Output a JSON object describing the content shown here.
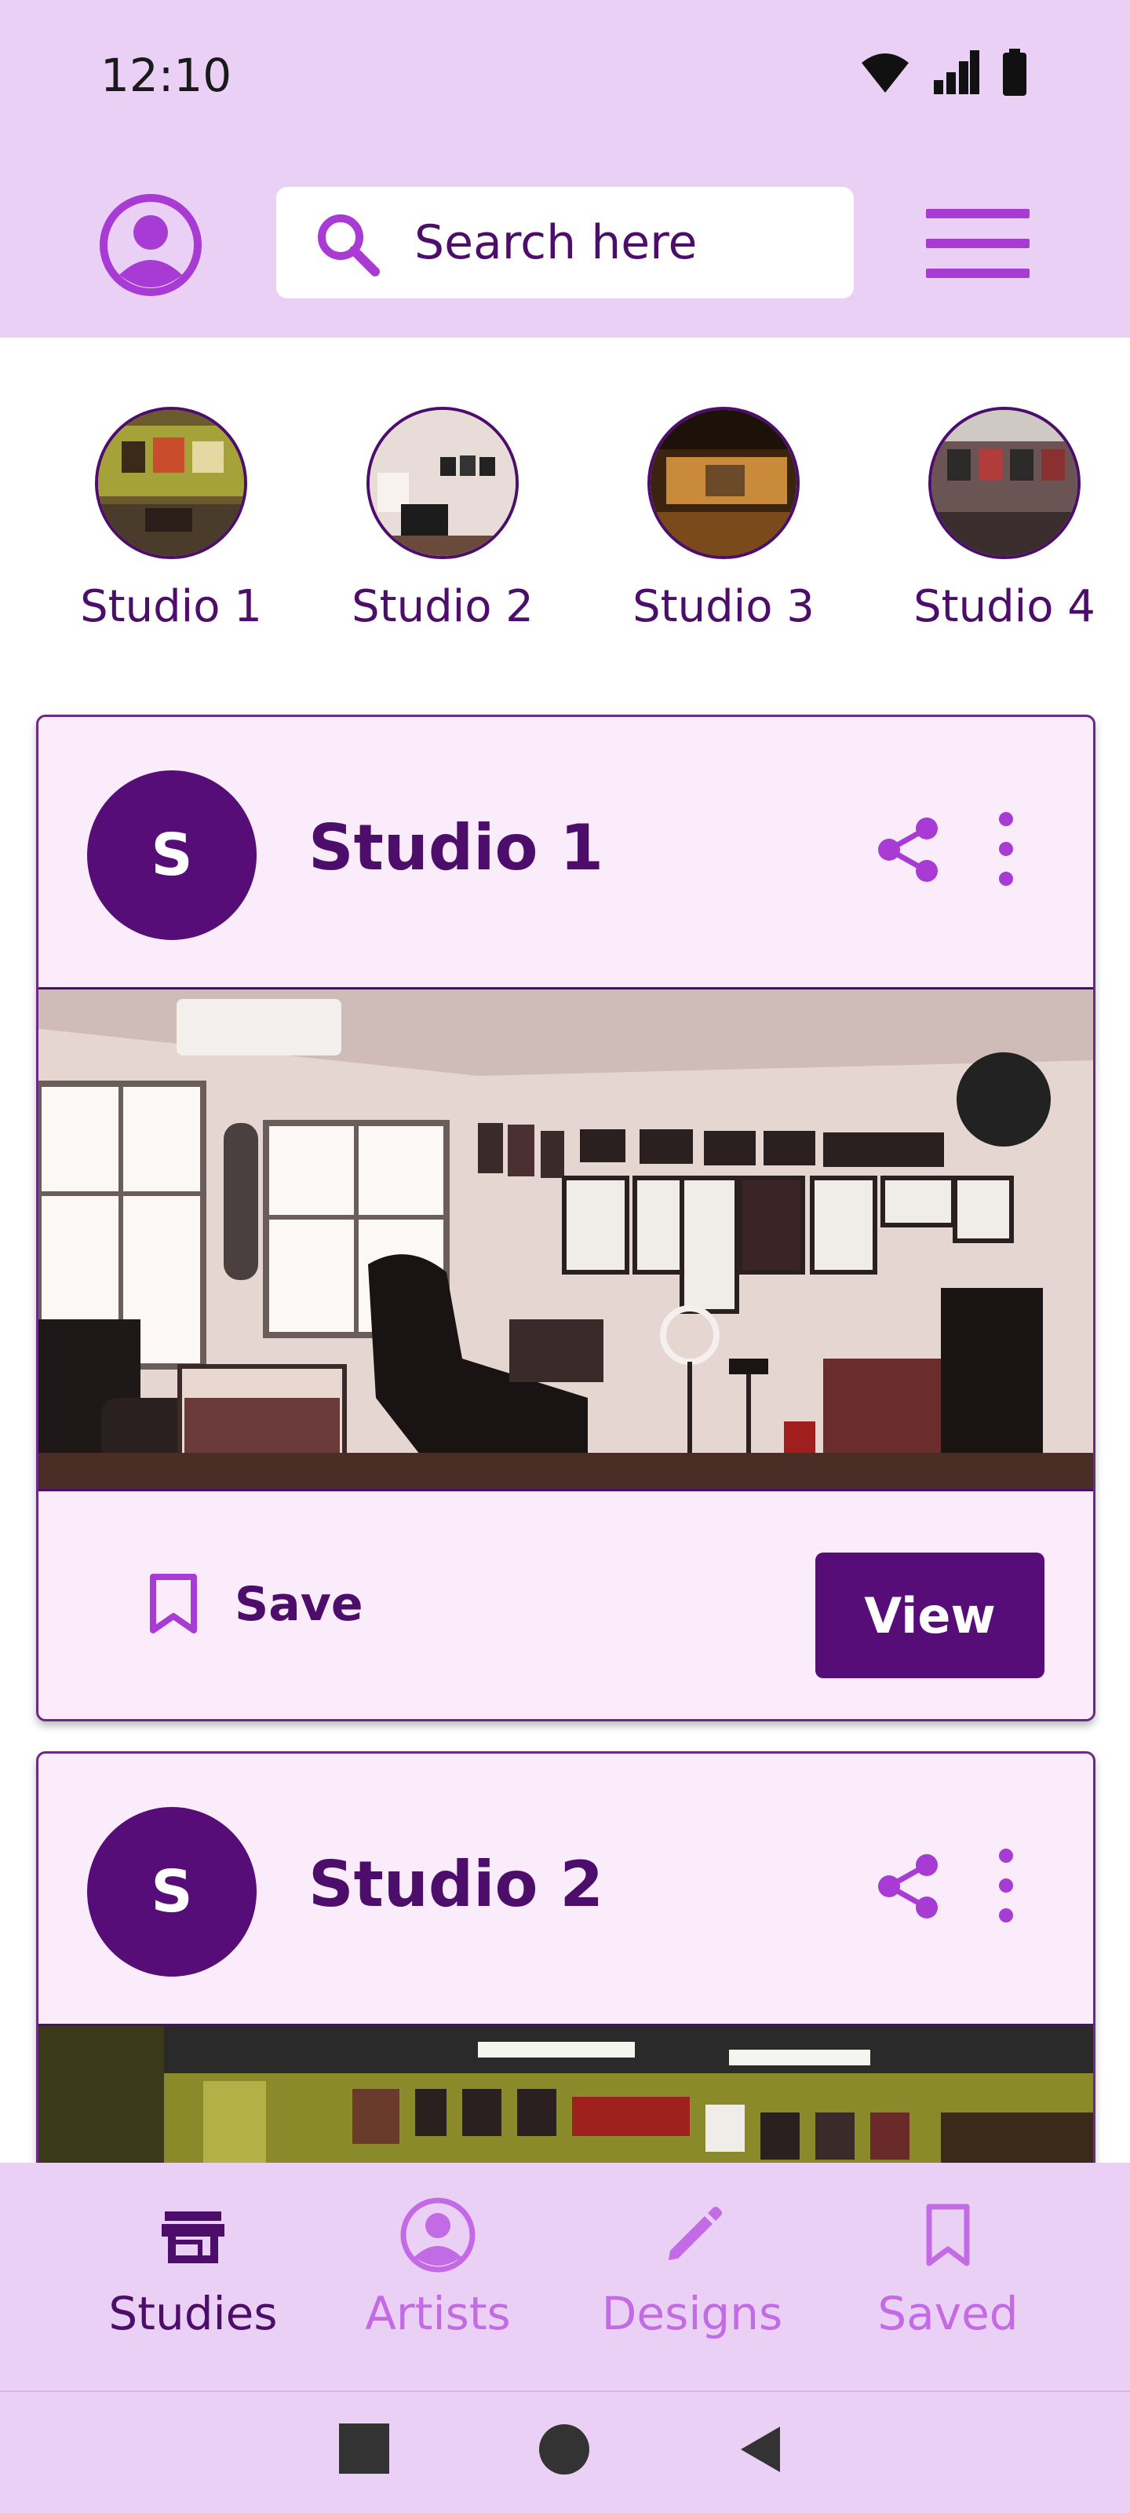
{
  "status_bar": {
    "time": "12:10"
  },
  "app_bar": {
    "search": {
      "placeholder": "Search here"
    }
  },
  "stories": [
    {
      "label": "Studio 1"
    },
    {
      "label": "Studio 2"
    },
    {
      "label": "Studio 3"
    },
    {
      "label": "Studio 4"
    }
  ],
  "cards": [
    {
      "avatar_letter": "S",
      "title": "Studio 1",
      "save_label": "Save",
      "view_label": "View"
    },
    {
      "avatar_letter": "S",
      "title": "Studio 2"
    }
  ],
  "bottom_nav": [
    {
      "label": "Studies",
      "icon": "storefront-icon",
      "active": true
    },
    {
      "label": "Artists",
      "icon": "account-circle-icon",
      "active": false
    },
    {
      "label": "Designs",
      "icon": "pencil-icon",
      "active": false
    },
    {
      "label": "Saved",
      "icon": "bookmark-icon",
      "active": false
    }
  ],
  "colors": {
    "primary": "#560d78",
    "accent": "#a83bd4",
    "app_bar_bg": "#ebd0f5",
    "card_bg": "#faecfb",
    "inactive_nav": "#c36ae5"
  }
}
